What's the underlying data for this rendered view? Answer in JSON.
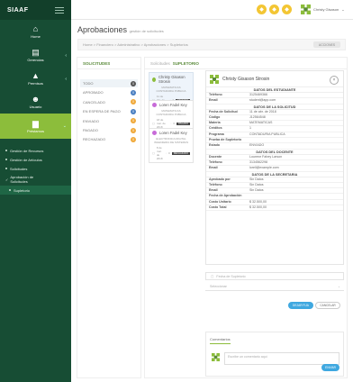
{
  "app": {
    "brand": "SIAAF"
  },
  "sidebar": {
    "items": [
      {
        "label": "Home",
        "icon": "home-icon"
      },
      {
        "label": "Gerencias",
        "icon": "building-icon"
      },
      {
        "label": "Permisos",
        "icon": "lock-icon"
      },
      {
        "label": "Usuario",
        "icon": "users-icon"
      },
      {
        "label": "Préstamos",
        "icon": "briefcase-icon"
      }
    ],
    "subitems": [
      "Gestión de Recursos",
      "Gestión de Artículos",
      "Solicitudes"
    ],
    "approval": "Aprobación de Solicitudes",
    "active_sub": "Supletorio"
  },
  "topbar": {
    "user": "Christy Gisason"
  },
  "page": {
    "title": "Aprobaciones",
    "subtitle": "gestión de solicitudes",
    "breadcrumb": "Home  >  Financiero  >  Administrativo  >  Aprobaciones  >  Supletorios",
    "action": "ACCIONES"
  },
  "statuses": {
    "header": "SOLICITUDES",
    "items": [
      {
        "label": "TODO",
        "count": "0",
        "color": "#555555"
      },
      {
        "label": "APROBADO",
        "count": "0",
        "color": "#4a7fc1"
      },
      {
        "label": "CANCELADO",
        "count": "0",
        "color": "#f0a93a"
      },
      {
        "label": "EN ESPERA DE PAGO",
        "count": "0",
        "color": "#4a7fc1"
      },
      {
        "label": "ENVIADO",
        "count": "0",
        "color": "#f0a93a"
      },
      {
        "label": "PAGADO",
        "count": "0",
        "color": "#f0a93a"
      },
      {
        "label": "RECHAZADO",
        "count": "0",
        "color": "#f0a93a"
      }
    ]
  },
  "main": {
    "label": "Solicitudes",
    "header": "SUPLETORIO"
  },
  "requests": [
    {
      "name": "Christy Gisason Strosin",
      "sub1": "MATEMATICAS",
      "sub2": "CONTADURIA PUBLICA",
      "date": "11 de abr. de 2018",
      "n": "0",
      "tag": "ENVIADO",
      "color": "#8cbd3b"
    },
    {
      "name": "Loren Fadel Key",
      "sub1": "MATEMATICAS",
      "sub2": "CONTADURIA PUBLICA",
      "date": "18 de mar. de 2018",
      "n": "0",
      "tag": "PAGADO",
      "color": "#c76bd8"
    },
    {
      "name": "Loren Fadel Key",
      "sub1": "ELECTRONICA DIGITAL",
      "sub2": "INGENIERIA DE SISTEMAS",
      "date": "8 de mar. de 2018",
      "n": "0",
      "tag": "RECHAZADO",
      "color": "#c76bd8"
    }
  ],
  "detail": {
    "name": "Christy Gisason Strosin",
    "close": "×",
    "sec_student": "DATOS DEL ESTUDIANTE",
    "student": [
      {
        "k": "Teléfono",
        "v": "3125469366"
      },
      {
        "k": "Email",
        "v": "student@app.com"
      }
    ],
    "sec_request": "DATOS DE LA SOLICITUD",
    "request": [
      {
        "k": "Fecha de Solicitud",
        "v": "11 de abr. de 2018"
      },
      {
        "k": "Código",
        "v": "J12564548"
      },
      {
        "k": "Materia",
        "v": "MATEMATICAS"
      },
      {
        "k": "Créditos",
        "v": "1"
      },
      {
        "k": "Programa",
        "v": "CONTADURIA PUBLICA"
      },
      {
        "k": "Prueba de Supletorio",
        "v": ""
      },
      {
        "k": "Estado",
        "v": "ENVIADO"
      }
    ],
    "sec_teacher": "DATOS DEL DOCENTE",
    "teacher": [
      {
        "k": "Docente",
        "v": "Lourene Fahey Larson"
      },
      {
        "k": "Teléfono",
        "v": "3134562298"
      },
      {
        "k": "Email",
        "v": "lorell@example.com"
      }
    ],
    "sec_secretary": "DATOS DE LA SECRETARIA",
    "secretary": [
      {
        "k": "Aprobado por",
        "v": "Sin Datos"
      },
      {
        "k": "Teléfono",
        "v": "Sin Datos"
      },
      {
        "k": "Email",
        "v": "Sin Datos"
      },
      {
        "k": "Fecha de Aprobación",
        "v": ""
      },
      {
        "k": "Costo Unitario",
        "v": "$ 32.500,00"
      },
      {
        "k": "Costo Total",
        "v": "$ 32.500,00"
      }
    ]
  },
  "form": {
    "date_placeholder": "Fecha de Supletorio",
    "select_placeholder": "Seleccionar",
    "approve": "DEJAR FIJA",
    "cancel": "CANCELAR"
  },
  "comments": {
    "tab": "Comentarios",
    "placeholder": "Escribe un comentario aquí",
    "send": "ENVIAR"
  }
}
